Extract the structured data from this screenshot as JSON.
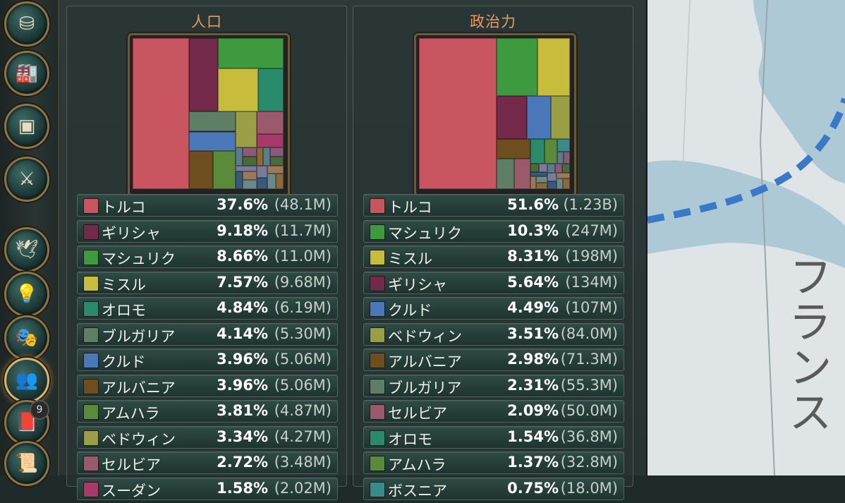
{
  "sidebar": {
    "buttons": [
      {
        "name": "treasury-button",
        "icon": "coins-icon",
        "glyph": "⛁"
      },
      {
        "name": "industry-button",
        "icon": "factory-icon",
        "glyph": "🏭"
      },
      {
        "name": "market-button",
        "icon": "crate-icon",
        "glyph": "▣"
      },
      {
        "name": "military-button",
        "icon": "crossed-swords-icon",
        "glyph": "⚔"
      },
      {
        "name": "diplomacy-button",
        "icon": "dove-icon",
        "glyph": "🕊"
      },
      {
        "name": "technology-button",
        "icon": "lightbulb-icon",
        "glyph": "💡"
      },
      {
        "name": "culture-button",
        "icon": "masks-icon",
        "glyph": "🎭"
      },
      {
        "name": "population-button",
        "icon": "people-icon",
        "glyph": "👥"
      },
      {
        "name": "journal-button",
        "icon": "book-icon",
        "glyph": "📕"
      },
      {
        "name": "laws-button",
        "icon": "scroll-icon",
        "glyph": "📜"
      }
    ],
    "journal_badge": "9"
  },
  "population": {
    "title": "人口",
    "entries": [
      {
        "name": "トルコ",
        "pct": "37.6%",
        "abs": "(48.1M)",
        "color": "#c95561"
      },
      {
        "name": "ギリシャ",
        "pct": "9.18%",
        "abs": "(11.7M)",
        "color": "#73294a"
      },
      {
        "name": "マシュリク",
        "pct": "8.66%",
        "abs": "(11.0M)",
        "color": "#3e9a3e"
      },
      {
        "name": "ミスル",
        "pct": "7.57%",
        "abs": "(9.68M)",
        "color": "#c8bc3c"
      },
      {
        "name": "オロモ",
        "pct": "4.84%",
        "abs": "(6.19M)",
        "color": "#2a8a6c"
      },
      {
        "name": "ブルガリア",
        "pct": "4.14%",
        "abs": "(5.30M)",
        "color": "#5e7e66"
      },
      {
        "name": "クルド",
        "pct": "3.96%",
        "abs": "(5.06M)",
        "color": "#4a78b8"
      },
      {
        "name": "アルバニア",
        "pct": "3.96%",
        "abs": "(5.06M)",
        "color": "#6e4e1e"
      },
      {
        "name": "アムハラ",
        "pct": "3.81%",
        "abs": "(4.87M)",
        "color": "#5a8a3a"
      },
      {
        "name": "ベドウィン",
        "pct": "3.34%",
        "abs": "(4.27M)",
        "color": "#9a9e44"
      },
      {
        "name": "セルビア",
        "pct": "2.72%",
        "abs": "(3.48M)",
        "color": "#9a5a6c"
      },
      {
        "name": "スーダン",
        "pct": "1.58%",
        "abs": "(2.02M)",
        "color": "#a83a6a"
      }
    ]
  },
  "political": {
    "title": "政治力",
    "entries": [
      {
        "name": "トルコ",
        "pct": "51.6%",
        "abs": "(1.23B)",
        "color": "#c95561"
      },
      {
        "name": "マシュリク",
        "pct": "10.3%",
        "abs": "(247M)",
        "color": "#3e9a3e"
      },
      {
        "name": "ミスル",
        "pct": "8.31%",
        "abs": "(198M)",
        "color": "#c8bc3c"
      },
      {
        "name": "ギリシャ",
        "pct": "5.64%",
        "abs": "(134M)",
        "color": "#73294a"
      },
      {
        "name": "クルド",
        "pct": "4.49%",
        "abs": "(107M)",
        "color": "#4a78b8"
      },
      {
        "name": "ベドウィン",
        "pct": "3.51%",
        "abs": "(84.0M)",
        "color": "#9a9e44"
      },
      {
        "name": "アルバニア",
        "pct": "2.98%",
        "abs": "(71.3M)",
        "color": "#6e4e1e"
      },
      {
        "name": "ブルガリア",
        "pct": "2.31%",
        "abs": "(55.3M)",
        "color": "#5e7e66"
      },
      {
        "name": "セルビア",
        "pct": "2.09%",
        "abs": "(50.0M)",
        "color": "#9a5a6c"
      },
      {
        "name": "オロモ",
        "pct": "1.54%",
        "abs": "(36.8M)",
        "color": "#2a8a6c"
      },
      {
        "name": "アムハラ",
        "pct": "1.37%",
        "abs": "(32.8M)",
        "color": "#5a8a3a"
      },
      {
        "name": "ボスニア",
        "pct": "0.75%",
        "abs": "(18.0M)",
        "color": "#3a8a8a"
      }
    ]
  },
  "map": {
    "label": "フランス",
    "sea_color": "#aec9d6",
    "route_color": "#3a78c8"
  }
}
